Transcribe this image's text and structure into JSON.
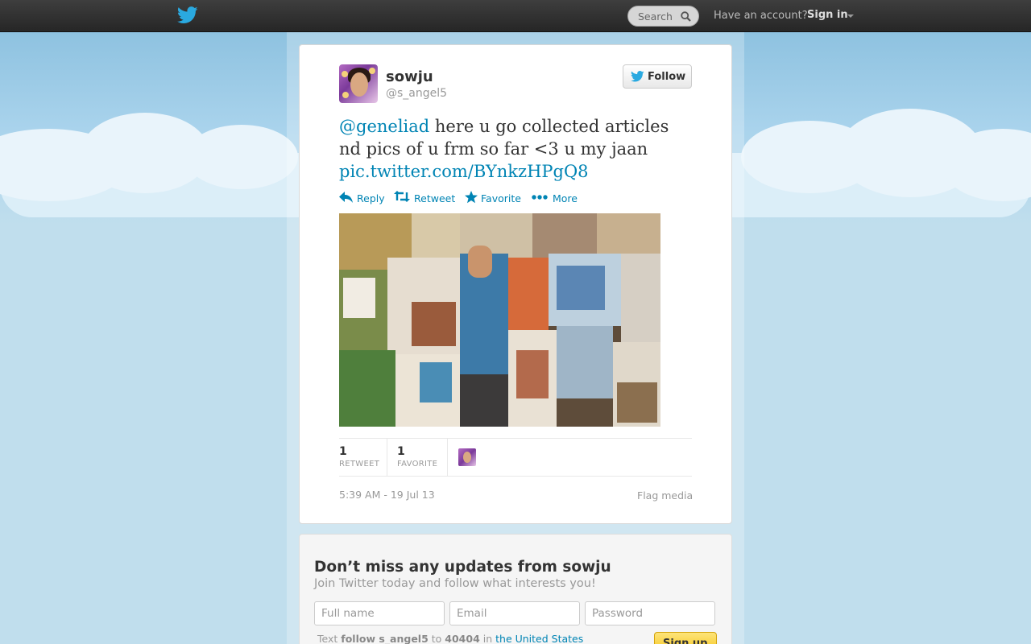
{
  "header": {
    "search_placeholder": "Search",
    "have_account": "Have an account?",
    "sign_in": "Sign in"
  },
  "tweet": {
    "display_name": "sowju",
    "screen_name": "@s_angel5",
    "follow_label": "Follow",
    "mention": "@geneliad",
    "body": " here u go collected articles nd pics of u frm so far <3 u my jaan ",
    "link": "pic.twitter.com/BYnkzHPgQ8",
    "actions": {
      "reply": "Reply",
      "retweet": "Retweet",
      "favorite": "Favorite",
      "more": "More"
    },
    "stats": {
      "retweets": "1",
      "retweet_label": "RETWEET",
      "favorites": "1",
      "favorite_label": "FAVORITE"
    },
    "timestamp": "5:39 AM - 19 Jul 13",
    "flag_media": "Flag media"
  },
  "signup": {
    "title": "Don’t miss any updates from sowju",
    "subtitle": "Join Twitter today and follow what interests you!",
    "full_name_placeholder": "Full name",
    "email_placeholder": "Email",
    "password_placeholder": "Password",
    "sms_prefix": "Text ",
    "sms_command": "follow s_angel5",
    "sms_to": " to ",
    "sms_number": "40404",
    "sms_in": " in ",
    "sms_country": "the United States",
    "button": "Sign up"
  },
  "colors": {
    "link": "#0084b4",
    "topbar": "#2c2c2c",
    "background": "#c0deed",
    "signup_button": "#f6c51a"
  },
  "icons": [
    "bird-icon",
    "search-icon",
    "reply-icon",
    "retweet-icon",
    "star-icon",
    "more-icon"
  ]
}
